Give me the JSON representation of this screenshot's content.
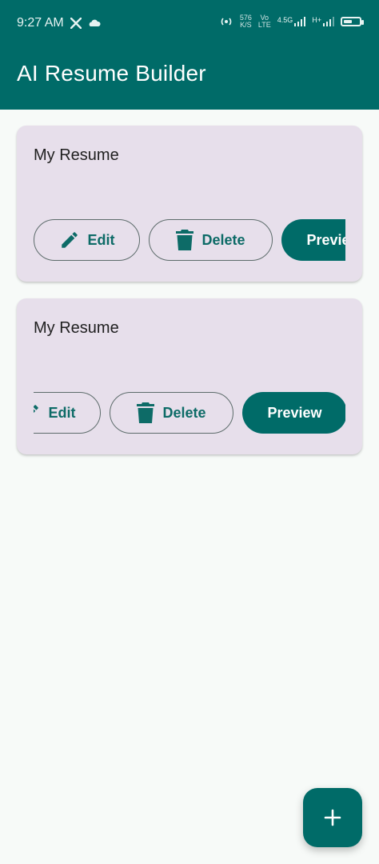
{
  "status_bar": {
    "time": "9:27 AM",
    "icons": [
      "x-icon",
      "cloud-icon",
      "hotspot-icon",
      "net-speed-icon",
      "volte-icon",
      "signal-4g-icon",
      "signal-h-icon",
      "battery-icon"
    ],
    "net_speed": {
      "value": "576",
      "unit": "K/S"
    },
    "volte_label": {
      "top": "Vo",
      "bottom": "LTE"
    },
    "sim1_label": "4.5G",
    "sim2_label": "H+"
  },
  "app_bar": {
    "title": "AI Resume Builder"
  },
  "cards": [
    {
      "title": "My Resume",
      "actions": {
        "edit": "Edit",
        "delete": "Delete",
        "preview": "Preview"
      }
    },
    {
      "title": "My Resume",
      "actions": {
        "edit": "Edit",
        "delete": "Delete",
        "preview": "Preview"
      }
    }
  ],
  "fab": {
    "icon": "plus-icon"
  },
  "colors": {
    "primary": "#006b68",
    "card_bg": "#e7dfeb",
    "background": "#f7faf8"
  }
}
